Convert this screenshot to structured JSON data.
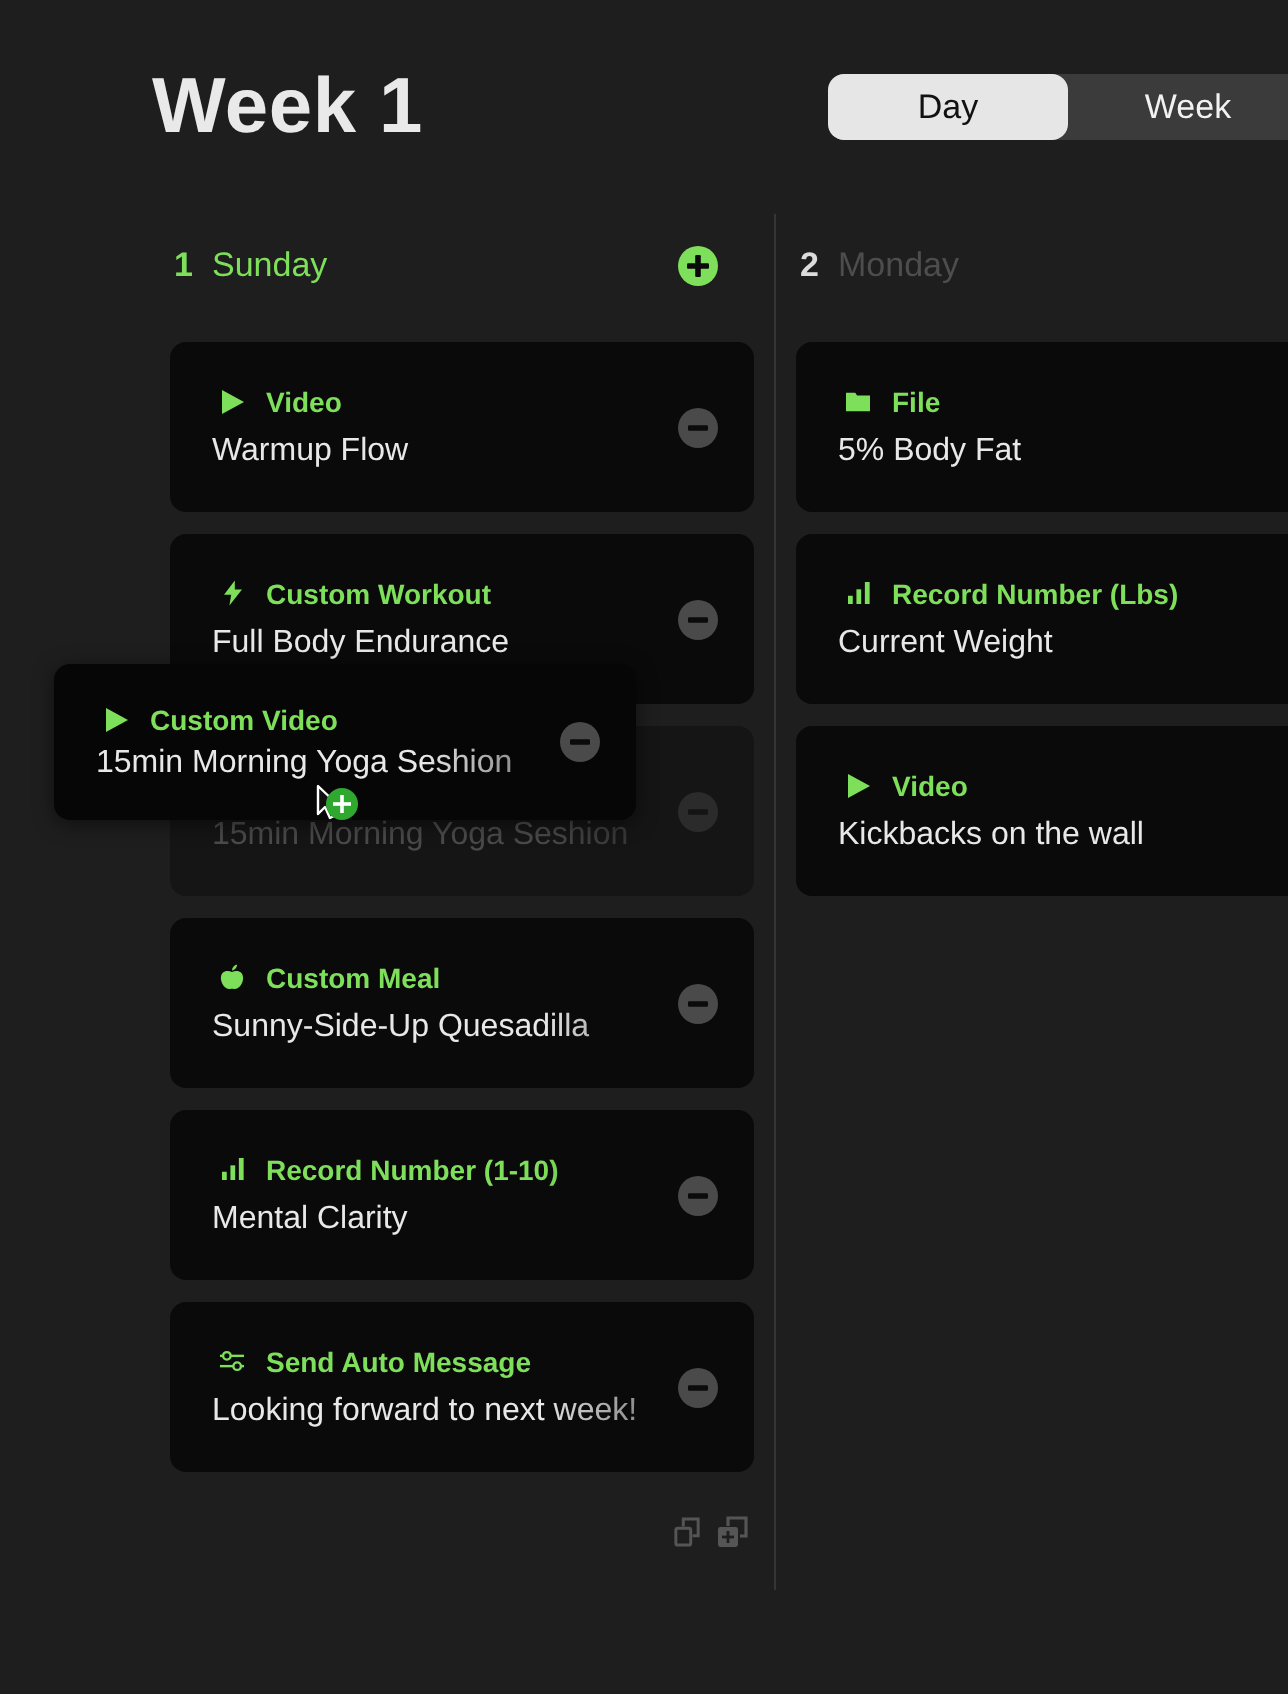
{
  "header": {
    "title": "Week 1"
  },
  "view_tabs": [
    {
      "label": "Day",
      "selected": true
    },
    {
      "label": "Week",
      "selected": false
    }
  ],
  "days": [
    {
      "number": "1",
      "name": "Sunday",
      "selected": true,
      "items": [
        {
          "kind": "video",
          "type_label": "Video",
          "title": "Warmup Flow",
          "dragging": false
        },
        {
          "kind": "workout",
          "type_label": "Custom Workout",
          "title": "Full Body Endurance",
          "dragging": false
        },
        {
          "title": "15min Morning Yoga Seshion",
          "dragging": true,
          "drag_preview": {
            "kind": "video",
            "type_label": "Custom Video",
            "title": "15min Morning Yoga Seshion"
          }
        },
        {
          "kind": "meal",
          "type_label": "Custom Meal",
          "title": "Sunny-Side-Up Quesadilla",
          "dragging": false
        },
        {
          "kind": "record",
          "type_label": "Record Number (1-10)",
          "title": "Mental Clarity",
          "dragging": false
        },
        {
          "kind": "message",
          "type_label": "Send Auto Message",
          "title": "Looking forward to next week!",
          "dragging": false
        }
      ]
    },
    {
      "number": "2",
      "name": "Monday",
      "selected": false,
      "items": [
        {
          "kind": "file",
          "type_label": "File",
          "title": "5% Body Fat",
          "dragging": false
        },
        {
          "kind": "record",
          "type_label": "Record Number (Lbs)",
          "title": "Current Weight",
          "dragging": false
        },
        {
          "kind": "video",
          "type_label": "Video",
          "title": "Kickbacks on the wall",
          "dragging": false
        }
      ]
    }
  ]
}
